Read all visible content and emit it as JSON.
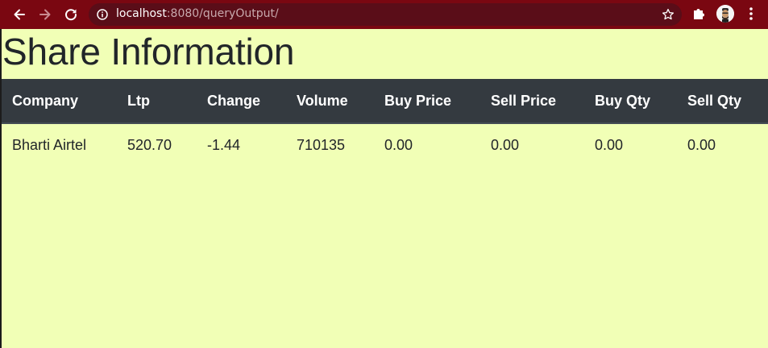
{
  "browser": {
    "url_host": "localhost",
    "url_rest": ":8080/queryOutput/",
    "icons": [
      "back-arrow-icon",
      "forward-arrow-icon",
      "reload-icon",
      "info-icon",
      "star-icon",
      "puzzle-extension-icon",
      "profile-avatar",
      "kebab-menu-icon"
    ],
    "toolbar_color": "#7a0711"
  },
  "page": {
    "title": "Share Information",
    "background": "#f1ffb6",
    "header_background": "#343a40"
  },
  "table": {
    "columns": [
      "Company",
      "Ltp",
      "Change",
      "Volume",
      "Buy Price",
      "Sell Price",
      "Buy Qty",
      "Sell Qty"
    ],
    "rows": [
      [
        "Bharti Airtel",
        "520.70",
        "-1.44",
        "710135",
        "0.00",
        "0.00",
        "0.00",
        "0.00"
      ]
    ]
  }
}
